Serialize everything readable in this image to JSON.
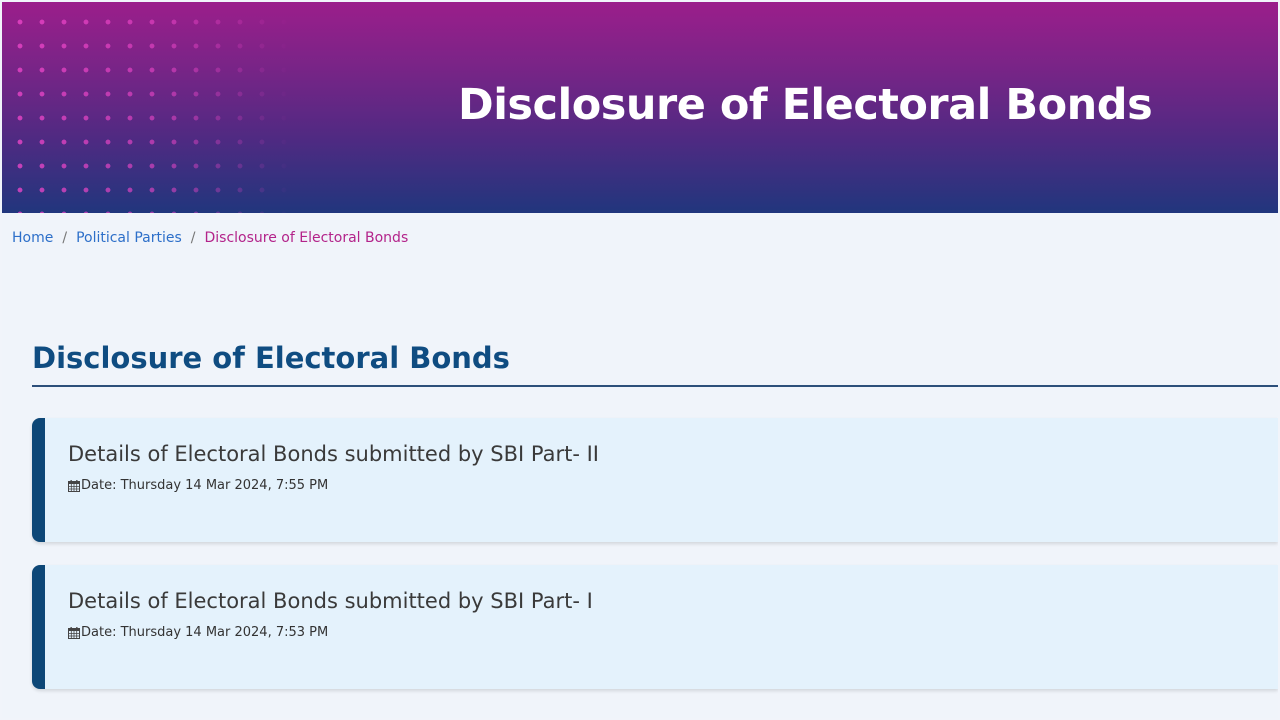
{
  "banner": {
    "title": "Disclosure of Electoral Bonds"
  },
  "breadcrumb": [
    {
      "label": "Home"
    },
    {
      "label": "Political Parties"
    },
    {
      "label": "Disclosure of Electoral Bonds"
    }
  ],
  "breadcrumb_separator": "/",
  "section": {
    "title": "Disclosure of Electoral Bonds"
  },
  "cards": [
    {
      "title": "Details of Electoral Bonds submitted by SBI Part- II",
      "date": "Date: Thursday 14 Mar 2024, 7:55 PM",
      "icon": "calendar-icon"
    },
    {
      "title": "Details of Electoral Bonds submitted by SBI Part- I",
      "date": "Date: Thursday 14 Mar 2024, 7:53 PM",
      "icon": "calendar-icon"
    }
  ],
  "colors": {
    "banner_top": "#9b1e8b",
    "banner_bottom": "#21367d",
    "link": "#2d6fc9",
    "breadcrumb_current": "#b3238a",
    "section_title": "#0f4c81",
    "card_bg": "#e4f2fc",
    "card_accent": "#0d4777"
  }
}
